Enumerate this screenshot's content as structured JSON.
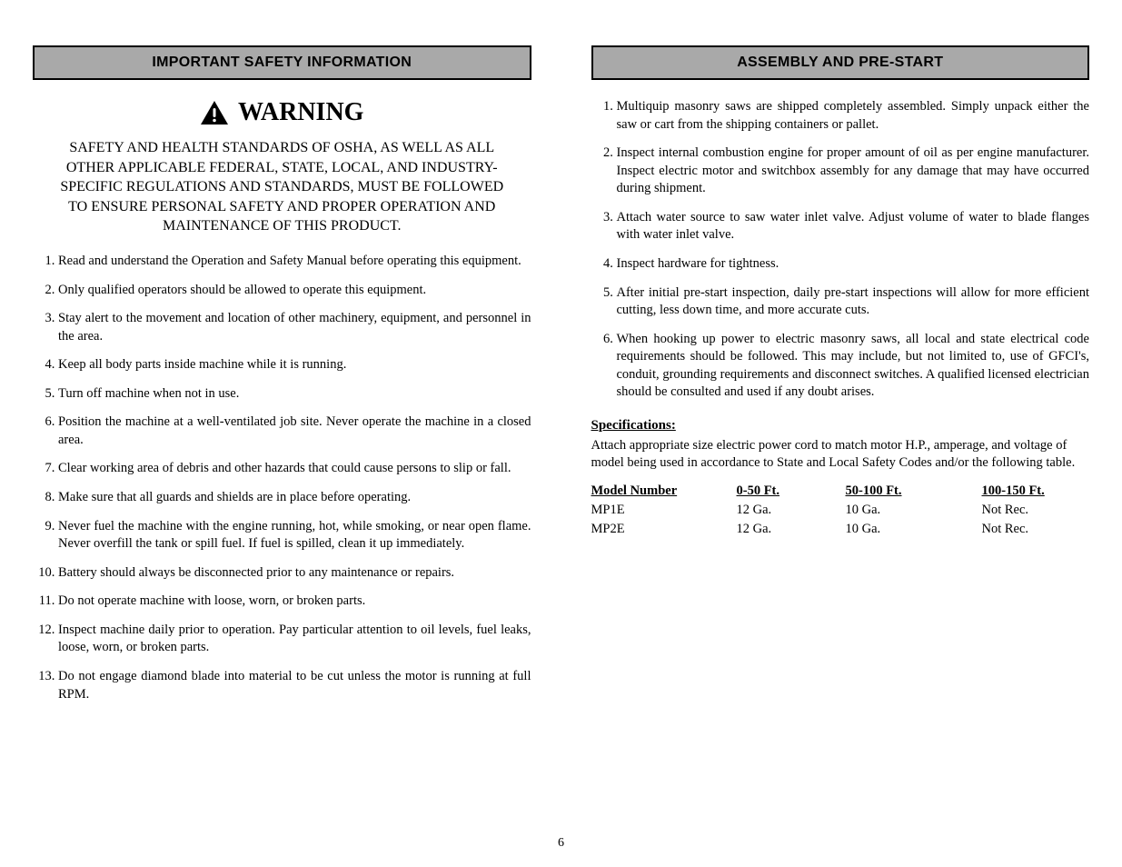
{
  "left": {
    "header": "IMPORTANT SAFETY INFORMATION",
    "warning_label": "WARNING",
    "warning_body": "SAFETY AND HEALTH STANDARDS OF OSHA, AS WELL AS ALL OTHER APPLICABLE FEDERAL, STATE, LOCAL, AND INDUSTRY-SPECIFIC REGULATIONS AND STANDARDS, MUST BE FOLLOWED TO ENSURE PERSONAL SAFETY AND PROPER OPERATION AND MAINTENANCE OF THIS PRODUCT.",
    "items": [
      "Read and understand the Operation and Safety Manual before operating this equipment.",
      "Only qualified operators should be allowed to operate this equipment.",
      "Stay alert to the movement and location of other machinery, equipment, and personnel in the area.",
      "Keep all body parts inside machine while it is running.",
      "Turn off machine when not in use.",
      "Position the machine at a well-ventilated job site. Never operate the machine in a closed area.",
      "Clear working area of debris and other hazards that could cause persons to slip or fall.",
      "Make sure that all guards and shields are in place before operating.",
      "Never fuel the machine with the engine running, hot, while smoking, or near open flame. Never overfill the tank or spill fuel. If fuel is spilled, clean it up immediately.",
      "Battery should always be disconnected prior to any maintenance or repairs.",
      "Do not operate machine with loose, worn, or broken parts.",
      "Inspect machine daily prior to operation. Pay particular attention to oil levels, fuel leaks, loose, worn, or broken parts.",
      "Do not engage diamond blade into material to be cut unless the motor is running at full RPM."
    ]
  },
  "right": {
    "header": "ASSEMBLY AND PRE-START",
    "items": [
      "Multiquip masonry saws are shipped completely assembled. Simply unpack either the saw or cart from the shipping containers or pallet.",
      "Inspect internal combustion engine for proper amount of oil as per engine manufacturer. Inspect electric motor and switchbox assembly for any damage that may have occurred during shipment.",
      "Attach water source to saw water inlet valve. Adjust volume of water to blade flanges with water inlet valve.",
      "Inspect hardware for tightness.",
      "After initial pre-start inspection, daily pre-start inspections will allow for more efficient cutting, less down time, and more accurate cuts.",
      "When hooking up power to electric masonry saws, all local and state electrical code requirements should be followed. This may include, but not limited to, use of GFCI's, conduit, grounding requirements and disconnect switches. A qualified licensed electrician should be consulted and used if any doubt arises."
    ],
    "spec1_heading": "Specifications:",
    "spec1_body": "Attach appropriate size electric power cord to match motor H.P., amperage, and voltage of model being used in accordance to State and Local Safety Codes and/or the following table.",
    "table": {
      "h1": "Model Number",
      "h2": "0-50 Ft.",
      "h3": "50-100 Ft.",
      "h4": "100-150 Ft.",
      "r1c1": "MP1E",
      "r1c2": "12 Ga.",
      "r1c3": "10 Ga.",
      "r1c4": "Not Rec.",
      "r2c1": "MP2E",
      "r2c2": "12 Ga.",
      "r2c3": "10 Ga.",
      "r2c4": "Not Rec."
    }
  },
  "page_number": "6"
}
